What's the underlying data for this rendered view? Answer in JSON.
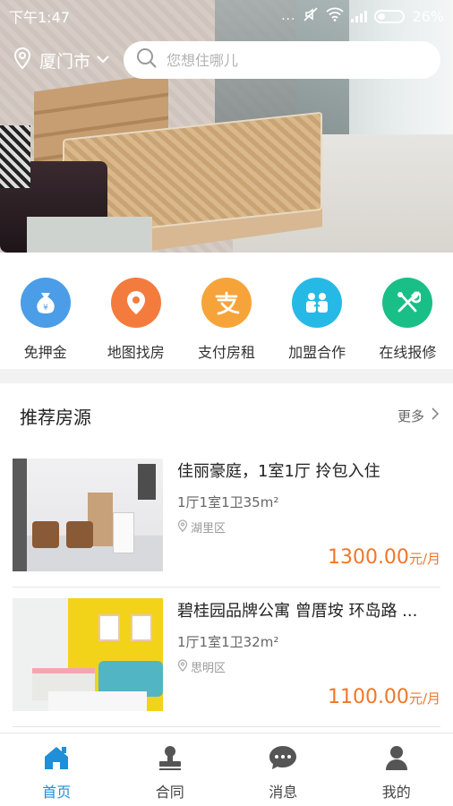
{
  "status_bar": {
    "time": "下午1:47",
    "more": "...",
    "battery": "26%"
  },
  "header": {
    "city": "厦门市",
    "search_placeholder": "您想住哪儿"
  },
  "quick_actions": [
    {
      "label": "免押金",
      "icon": "money-bag-icon",
      "color": "#4a9de6"
    },
    {
      "label": "地图找房",
      "icon": "location-pin-icon",
      "color": "#f47b3e"
    },
    {
      "label": "支付房租",
      "icon": "alipay-icon",
      "color": "#f6a43a"
    },
    {
      "label": "加盟合作",
      "icon": "partners-icon",
      "color": "#27b9e6"
    },
    {
      "label": "在线报修",
      "icon": "repair-tools-icon",
      "color": "#19bf86"
    }
  ],
  "recommend": {
    "title": "推荐房源",
    "more": "更多",
    "listings": [
      {
        "title": "佳丽豪庭，1室1厅 拎包入住",
        "spec": "1厅1室1卫35m²",
        "district": "湖里区",
        "price": "1300.00",
        "unit": "元/月"
      },
      {
        "title": "碧桂园品牌公寓 曾厝垵 环岛路 ...",
        "spec": "1厅1室1卫32m²",
        "district": "思明区",
        "price": "1100.00",
        "unit": "元/月"
      }
    ]
  },
  "tabbar": [
    {
      "label": "首页",
      "icon": "home-icon",
      "active": true
    },
    {
      "label": "合同",
      "icon": "stamp-icon",
      "active": false
    },
    {
      "label": "消息",
      "icon": "message-icon",
      "active": false
    },
    {
      "label": "我的",
      "icon": "user-icon",
      "active": false
    }
  ],
  "colors": {
    "accent": "#1e8fd8",
    "price": "#f0772a"
  }
}
